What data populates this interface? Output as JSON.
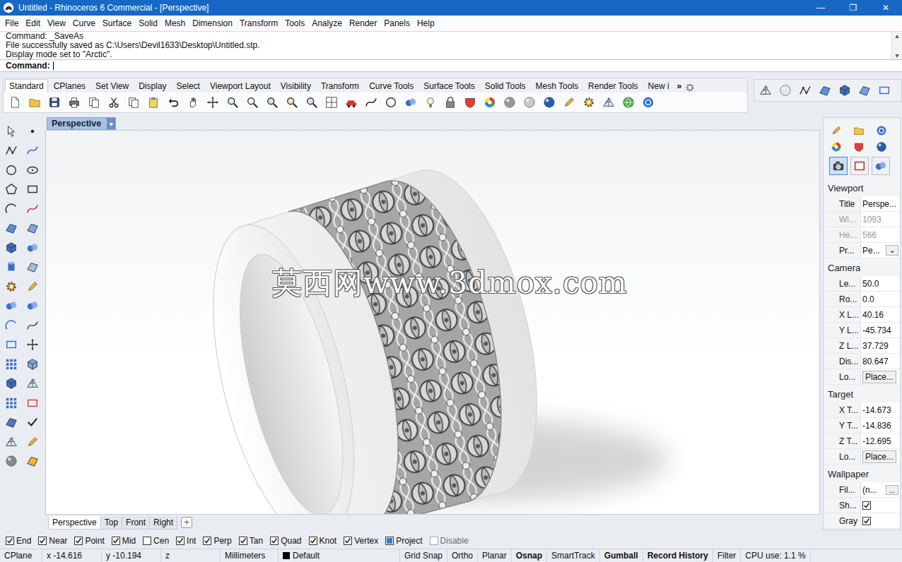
{
  "window": {
    "title": "Untitled - Rhinoceros 6 Commercial - [Perspective]",
    "controls": [
      "—",
      "❐",
      "✕"
    ]
  },
  "menu": [
    "File",
    "Edit",
    "View",
    "Curve",
    "Surface",
    "Solid",
    "Mesh",
    "Dimension",
    "Transform",
    "Tools",
    "Analyze",
    "Render",
    "Panels",
    "Help"
  ],
  "command": {
    "history": [
      "Command: _SaveAs",
      "File successfully saved as C:\\Users\\Devil1633\\Desktop\\Untitled.stp.",
      "Display mode set to \"Arctic\"."
    ],
    "prompt": "Command:",
    "value": "",
    "scroll_arrows": [
      "▴",
      "▾"
    ]
  },
  "toolbar": {
    "tabs": [
      {
        "label": "Standard",
        "selected": true
      },
      {
        "label": "CPlanes",
        "selected": false
      },
      {
        "label": "Set View",
        "selected": false
      },
      {
        "label": "Display",
        "selected": false
      },
      {
        "label": "Select",
        "selected": false
      },
      {
        "label": "Viewport Layout",
        "selected": false
      },
      {
        "label": "Visibility",
        "selected": false
      },
      {
        "label": "Transform",
        "selected": false
      },
      {
        "label": "Curve Tools",
        "selected": false
      },
      {
        "label": "Surface Tools",
        "selected": false
      },
      {
        "label": "Solid Tools",
        "selected": false
      },
      {
        "label": "Mesh Tools",
        "selected": false
      },
      {
        "label": "Render Tools",
        "selected": false
      },
      {
        "label": "New i",
        "selected": false
      }
    ],
    "overflow": "»"
  },
  "viewport": {
    "title": "Perspective",
    "menu_arrow": "▾",
    "watermark": "莫西网www.3dmox.com"
  },
  "viewport_tabs": [
    {
      "label": "Perspective",
      "selected": true
    },
    {
      "label": "Top",
      "selected": false
    },
    {
      "label": "Front",
      "selected": false
    },
    {
      "label": "Right",
      "selected": false
    }
  ],
  "add_tab": "+",
  "properties": {
    "tabs": [
      {
        "selected": true
      },
      {
        "selected": false
      },
      {
        "selected": false
      }
    ],
    "sections": [
      {
        "title": "Viewport",
        "rows": [
          {
            "label": "Title",
            "value": "Perspe...",
            "kind": "text",
            "disabled": false
          },
          {
            "label": "Wi...",
            "value": "1093",
            "kind": "text",
            "disabled": true
          },
          {
            "label": "He...",
            "value": "566",
            "kind": "text",
            "disabled": true
          },
          {
            "label": "Pr...",
            "value": "Pe...",
            "kind": "dropdown",
            "button": "⌄",
            "disabled": false
          }
        ]
      },
      {
        "title": "Camera",
        "rows": [
          {
            "label": "Le...",
            "value": "50.0",
            "kind": "text",
            "disabled": false
          },
          {
            "label": "Ro...",
            "value": "0.0",
            "kind": "text",
            "disabled": false
          },
          {
            "label": "X L...",
            "value": "40.16",
            "kind": "text",
            "disabled": false
          },
          {
            "label": "Y L...",
            "value": "-45.734",
            "kind": "text",
            "disabled": false
          },
          {
            "label": "Z L...",
            "value": "37.729",
            "kind": "text",
            "disabled": false
          },
          {
            "label": "Dis...",
            "value": "80.647",
            "kind": "text",
            "disabled": false
          },
          {
            "label": "Lo...",
            "value": "Place...",
            "kind": "button",
            "disabled": false
          }
        ]
      },
      {
        "title": "Target",
        "rows": [
          {
            "label": "X T...",
            "value": "-14.673",
            "kind": "text",
            "disabled": false
          },
          {
            "label": "Y T...",
            "value": "-14.836",
            "kind": "text",
            "disabled": false
          },
          {
            "label": "Z T...",
            "value": "-12.695",
            "kind": "text",
            "disabled": false
          },
          {
            "label": "Lo...",
            "value": "Place...",
            "kind": "button",
            "disabled": false
          }
        ]
      },
      {
        "title": "Wallpaper",
        "rows": [
          {
            "label": "Fil...",
            "value": "(n...",
            "kind": "browse",
            "button": "...",
            "disabled": false
          },
          {
            "label": "Sh...",
            "kind": "checkbox",
            "checked": true,
            "disabled": false
          },
          {
            "label": "Gray",
            "kind": "checkbox",
            "checked": true,
            "disabled": false
          }
        ]
      }
    ]
  },
  "osnap": [
    {
      "label": "End",
      "checked": true,
      "indeterminate": false,
      "disabled": false
    },
    {
      "label": "Near",
      "checked": true,
      "indeterminate": false,
      "disabled": false
    },
    {
      "label": "Point",
      "checked": true,
      "indeterminate": false,
      "disabled": false
    },
    {
      "label": "Mid",
      "checked": true,
      "indeterminate": false,
      "disabled": false
    },
    {
      "label": "Cen",
      "checked": false,
      "indeterminate": false,
      "disabled": false
    },
    {
      "label": "Int",
      "checked": true,
      "indeterminate": false,
      "disabled": false
    },
    {
      "label": "Perp",
      "checked": true,
      "indeterminate": false,
      "disabled": false
    },
    {
      "label": "Tan",
      "checked": true,
      "indeterminate": false,
      "disabled": false
    },
    {
      "label": "Quad",
      "checked": true,
      "indeterminate": false,
      "disabled": false
    },
    {
      "label": "Knot",
      "checked": true,
      "indeterminate": false,
      "disabled": false
    },
    {
      "label": "Vertex",
      "checked": true,
      "indeterminate": false,
      "disabled": false
    },
    {
      "label": "Project",
      "checked": false,
      "indeterminate": true,
      "disabled": false
    },
    {
      "label": "Disable",
      "checked": false,
      "indeterminate": false,
      "disabled": true
    }
  ],
  "status_bar": [
    {
      "label": "CPlane",
      "kind": "cplane",
      "active": false
    },
    {
      "label": "x -14.616",
      "kind": "coord",
      "active": false
    },
    {
      "label": "y -10.194",
      "kind": "coord",
      "active": false
    },
    {
      "label": "z",
      "kind": "coord",
      "active": false
    },
    {
      "label": "Millimeters",
      "kind": "units",
      "active": false
    },
    {
      "label": "Default",
      "kind": "layer",
      "active": false,
      "color": "#000000"
    },
    {
      "label": "Grid Snap",
      "kind": "toggle",
      "active": false
    },
    {
      "label": "Ortho",
      "kind": "toggle",
      "active": false
    },
    {
      "label": "Planar",
      "kind": "toggle",
      "active": false
    },
    {
      "label": "Osnap",
      "kind": "toggle",
      "active": true
    },
    {
      "label": "SmartTrack",
      "kind": "toggle",
      "active": false
    },
    {
      "label": "Gumball",
      "kind": "toggle",
      "active": true
    },
    {
      "label": "Record History",
      "kind": "toggle",
      "active": true
    },
    {
      "label": "Filter",
      "kind": "toggle",
      "active": false
    },
    {
      "label": "CPU use: 1.1 %",
      "kind": "info",
      "active": false
    }
  ]
}
